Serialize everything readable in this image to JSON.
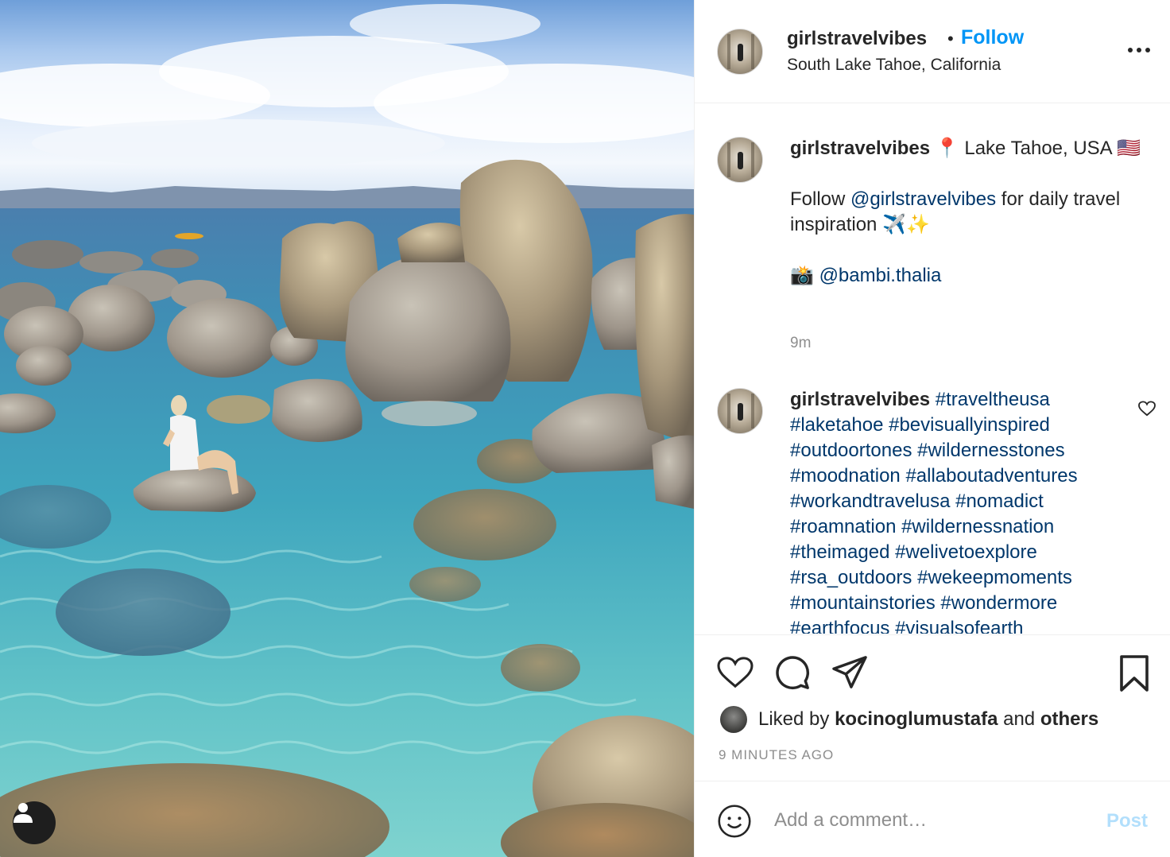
{
  "post": {
    "photo_alt": "",
    "user_tag_icon": "user-icon"
  },
  "header": {
    "username": "girlstravelvibes",
    "separator": "•",
    "follow_label": "Follow",
    "location": "South Lake Tahoe, California",
    "more_icon": "more-options-icon"
  },
  "caption": {
    "username": "girlstravelvibes",
    "pin_emoji": "📍",
    "line1_text": " Lake Tahoe, USA ",
    "flag_emoji": "🇺🇸",
    "follow_prefix": "Follow ",
    "mention_main": "@girlstravelvibes",
    "follow_suffix": " for daily travel inspiration ✈️✨",
    "camera_emoji": "📸 ",
    "mention_photo": "@bambi.thalia",
    "time": "9m"
  },
  "comment": {
    "username": "girlstravelvibes",
    "hashtags": "#traveltheusa #laketahoe #bevisuallyinspired #outdoortones #wildernesstones #moodnation #allaboutadventures #workandtravelusa #nomadict #roamnation #wildernessnation #theimaged #welivetoexplore #rsa_outdoors #wekeepmoments #mountainstories #wondermore #earthfocus #visualsofearth"
  },
  "actions": {
    "liked_prefix": "Liked by ",
    "liked_user": "kocinoglumustafa",
    "liked_mid": " and ",
    "liked_others": "others",
    "posted_ago": "9 MINUTES AGO"
  },
  "add_comment": {
    "placeholder": "Add a comment…",
    "post_label": "Post"
  },
  "colors": {
    "link_blue": "#0095f6",
    "hashtag_blue": "#00376b",
    "post_disabled": "#b2dffc",
    "muted": "#8e8e8e"
  }
}
